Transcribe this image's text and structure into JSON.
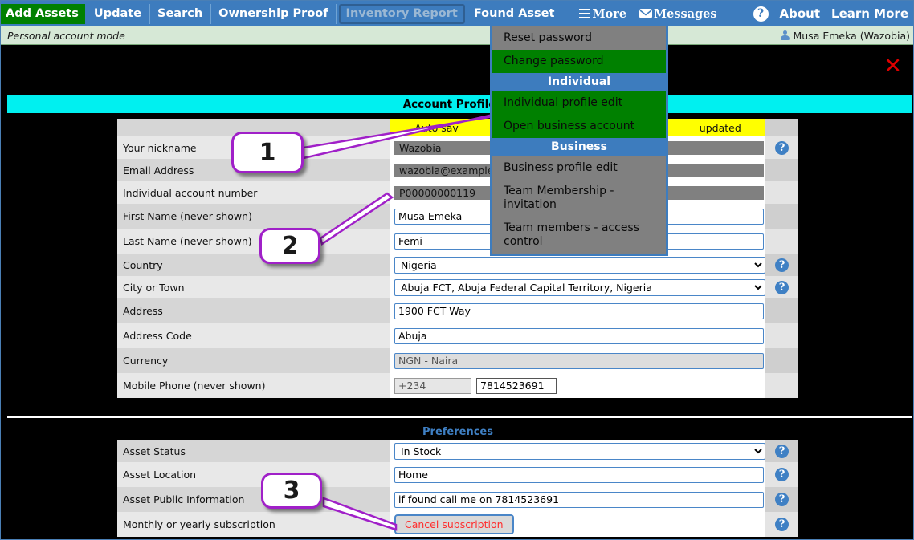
{
  "topnav": {
    "tabs": [
      {
        "label": "Add Assets",
        "state": "active"
      },
      {
        "label": "Update",
        "state": "normal"
      },
      {
        "label": "Search",
        "state": "normal"
      },
      {
        "label": "Ownership Proof",
        "state": "normal"
      },
      {
        "label": "Inventory Report",
        "state": "disabled"
      },
      {
        "label": "Found Asset",
        "state": "normal"
      }
    ],
    "more_label": "More",
    "messages_label": "Messages",
    "help_glyph": "?",
    "about_label": "About",
    "learn_more_label": "Learn More"
  },
  "modebar": {
    "mode_text": "Personal account mode",
    "user_text": "Musa Emeka (Wazobia)"
  },
  "dropdown": {
    "items": [
      {
        "label": "Reset password",
        "style": "gray"
      },
      {
        "label": "Change password",
        "style": "green"
      }
    ],
    "individual_header": "Individual",
    "individual_items": [
      {
        "label": "Individual profile edit",
        "style": "green"
      },
      {
        "label": "Open business account",
        "style": "green"
      }
    ],
    "business_header": "Business",
    "business_items": [
      {
        "label": "Business profile edit",
        "style": "gray"
      },
      {
        "label": "Team Membership - invitation",
        "style": "gray"
      },
      {
        "label": "Team members - access control",
        "style": "gray"
      }
    ]
  },
  "page": {
    "close_glyph": "✕",
    "title": "Account Profile - P",
    "autosave_left": "Auto sav",
    "autosave_right": "updated",
    "preferences_title": "Preferences"
  },
  "profile": {
    "rows": [
      {
        "label": "Your nickname",
        "value": "Wazobia",
        "type": "readonly",
        "help": true
      },
      {
        "label": "Email Address",
        "value": "wazobia@example",
        "type": "readonly",
        "help": false
      },
      {
        "label": "Individual account number",
        "value": "P00000000119",
        "type": "readonly",
        "help": false
      },
      {
        "label": "First Name (never shown)",
        "value": "Musa Emeka",
        "type": "text",
        "help": false
      },
      {
        "label": "Last Name (never shown)",
        "value": "Femi",
        "type": "text",
        "help": false
      },
      {
        "label": "Country",
        "value": "Nigeria",
        "type": "select",
        "help": true
      },
      {
        "label": "City or Town",
        "value": "Abuja FCT, Abuja Federal Capital Territory, Nigeria",
        "type": "select",
        "help": true
      },
      {
        "label": "Address",
        "value": "1900 FCT Way",
        "type": "text",
        "help": false
      },
      {
        "label": "Address Code",
        "value": "Abuja",
        "type": "text",
        "help": false
      },
      {
        "label": "Currency",
        "value": "NGN - Naira",
        "type": "text-disabled",
        "help": false
      },
      {
        "label": "Mobile Phone (never shown)",
        "value": "7814523691",
        "code": "+234",
        "type": "phone",
        "help": false
      }
    ]
  },
  "preferences": {
    "rows": [
      {
        "label": "Asset Status",
        "value": "In Stock",
        "type": "select",
        "help": true
      },
      {
        "label": "Asset Location",
        "value": "Home",
        "type": "text",
        "help": true
      },
      {
        "label": "Asset Public Information",
        "value": "if found call me on 7814523691",
        "type": "text",
        "help": true
      },
      {
        "label": "Monthly or yearly subscription",
        "value": "Cancel subscription",
        "type": "button",
        "help": true
      }
    ]
  },
  "callouts": [
    {
      "number": "1"
    },
    {
      "number": "2"
    },
    {
      "number": "3"
    }
  ],
  "colors": {
    "nav_blue": "#3d7cbe",
    "active_green": "#008000",
    "title_cyan": "#00f0f0",
    "autosave_yellow": "#ffff00",
    "callout_purple": "#a020c8",
    "cancel_red": "#ff2d2d",
    "close_red": "#e00000"
  }
}
